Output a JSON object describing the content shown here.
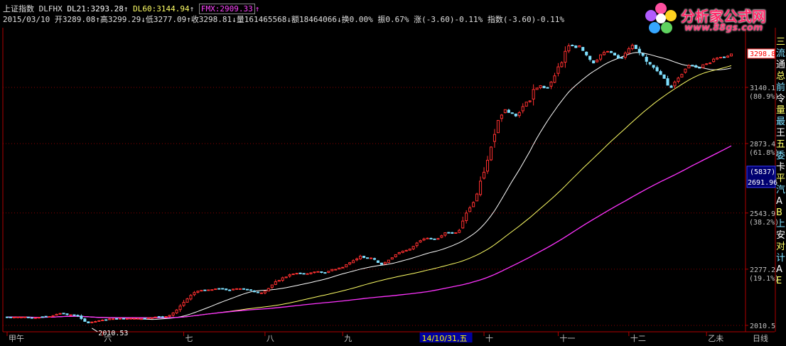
{
  "header": {
    "index_name": "上证指数",
    "indicator": "DLFHX",
    "dl21_label": "DL21:3293.28",
    "dl60_label": "DL60:3144.94",
    "fmx_label": "FMX:2909.33",
    "date": "2015/03/10",
    "open": "开3289.08",
    "high": "高3299.29",
    "low": "低3277.09",
    "close": "收3298.81",
    "volume": "量161465568",
    "amount": "额18464066",
    "turnover": "换0.00%",
    "amplitude": "振0.67%",
    "change": "涨(-3.60)-0.11%",
    "index_change": "指数(-3.60)-0.11%"
  },
  "logo": {
    "name": "分析家公式网",
    "url": "www.88gs.com"
  },
  "right_panel": [
    "三",
    "流",
    "通",
    "总",
    "前",
    "令",
    "量",
    "最",
    "王",
    "五",
    "委",
    "卡",
    "平",
    "汽",
    "A",
    "B",
    "上",
    "安",
    "对",
    "计",
    "A",
    "E"
  ],
  "colors": {
    "bull": "#ff3030",
    "bear": "#7fe0ff",
    "ma21": "#ffffff",
    "ma60": "#ffff66",
    "fmx": "#ff33ff",
    "axis": "#b00000",
    "grid": "#8b0000",
    "price_box": "#ffffff"
  },
  "chart_data": {
    "type": "candlestick",
    "price_range": [
      1980,
      3420
    ],
    "y_ticks": [
      {
        "value": 3140.1,
        "label": "3140.1",
        "pct": "(80.9%)"
      },
      {
        "value": 2873.4,
        "label": "2873.4",
        "pct": "(61.8%)"
      },
      {
        "value": 2543.9,
        "label": "2543.9",
        "pct": "(38.2%)"
      },
      {
        "value": 2277.2,
        "label": "2277.2",
        "pct": "(19.1%)"
      },
      {
        "value": 2010.5,
        "label": "2010.5",
        "pct": ""
      }
    ],
    "current_price": {
      "value": 3298.8,
      "label": "3298.8"
    },
    "cursor": {
      "value": 2691.96,
      "label": "2691.96",
      "count": "(5837)"
    },
    "low_annotation": {
      "value": 2010.53,
      "label": "2010.53",
      "index": 24
    },
    "x_labels": [
      {
        "label": "甲午",
        "index": 0
      },
      {
        "label": "六",
        "index": 27
      },
      {
        "label": "七",
        "index": 50
      },
      {
        "label": "八",
        "index": 73
      },
      {
        "label": "九",
        "index": 95
      },
      {
        "label": "14/10/31,五",
        "index": 117
      },
      {
        "label": "十",
        "index": 135
      },
      {
        "label": "十一",
        "index": 156
      },
      {
        "label": "十二",
        "index": 176
      },
      {
        "label": "乙未",
        "index": 198
      },
      {
        "label": "日线",
        "index": 215
      }
    ],
    "closes": [
      2050.2,
      2049.8,
      2049.2,
      2049.8,
      2049.5,
      2050.3,
      2048.3,
      2045.5,
      2046.5,
      2048.1,
      2049.9,
      2051.4,
      2052.5,
      2056.4,
      2063.1,
      2067.0,
      2066.2,
      2061.8,
      2061.0,
      2058.7,
      2054.9,
      2042.9,
      2029.4,
      2022.5,
      2026.1,
      2028.9,
      2032.7,
      2035.7,
      2037.1,
      2041.4,
      2041.6,
      2041.4,
      2043.3,
      2042.0,
      2042.8,
      2043.6,
      2043.1,
      2043.3,
      2041.9,
      2042.8,
      2045.6,
      2046.6,
      2050.3,
      2052.1,
      2049.7,
      2052.5,
      2057.9,
      2069.4,
      2083.6,
      2102.1,
      2119.6,
      2136.3,
      2152.8,
      2166.3,
      2172.9,
      2176.8,
      2176.0,
      2179.0,
      2180.0,
      2183.8,
      2184.7,
      2183.9,
      2179.0,
      2176.1,
      2182.8,
      2184.6,
      2184.4,
      2182.5,
      2180.5,
      2177.8,
      2169.6,
      2166.6,
      2164.7,
      2172.7,
      2185.2,
      2202.3,
      2217.9,
      2224.3,
      2236.4,
      2240.4,
      2250.7,
      2254.8,
      2257.5,
      2257.6,
      2256.4,
      2255.8,
      2260.1,
      2264.1,
      2266.0,
      2262.4,
      2260.5,
      2267.4,
      2275.9,
      2276.5,
      2282.9,
      2286.0,
      2298.5,
      2308.1,
      2317.6,
      2326.1,
      2338.9,
      2331.9,
      2329.6,
      2330.3,
      2323.8,
      2308.8,
      2300.2,
      2309.4,
      2320.2,
      2331.7,
      2346.0,
      2355.9,
      2362.9,
      2366.6,
      2372.7,
      2385.4,
      2401.3,
      2412.8,
      2421.1,
      2424.4,
      2421.5,
      2419.3,
      2422.6,
      2436.1,
      2450.3,
      2450.8,
      2448.6,
      2450.4,
      2461.6,
      2505.7,
      2543.8,
      2568.1,
      2593.5,
      2634.0,
      2695.2,
      2737.4,
      2794.2,
      2857.0,
      2916.8,
      2983.5,
      3008.9,
      3034.5,
      3021.0,
      3016.3,
      3004.7,
      3020.4,
      3049.0,
      3070.2,
      3076.1,
      3130.2,
      3137.1,
      3148.2,
      3138.1,
      3137.8,
      3165.2,
      3195.0,
      3237.5,
      3257.2,
      3311.2,
      3337.3,
      3339.0,
      3329.1,
      3337.4,
      3315.2,
      3294.3,
      3272.8,
      3256.0,
      3269.3,
      3294.9,
      3306.6,
      3310.8,
      3305.1,
      3293.4,
      3278.3,
      3280.2,
      3302.7,
      3323.6,
      3339.8,
      3324.0,
      3305.0,
      3292.2,
      3263.7,
      3251.2,
      3235.3,
      3218.6,
      3201.0,
      3182.9,
      3150.5,
      3139.6,
      3165.4,
      3184.3,
      3201.8,
      3227.0,
      3243.6,
      3243.8,
      3235.5,
      3233.5,
      3247.8,
      3252.2,
      3256.0,
      3274.3,
      3279.7,
      3283.4,
      3282.6,
      3288.5,
      3298.8
    ],
    "series": [
      {
        "name": "DL21",
        "period": 21
      },
      {
        "name": "DL60",
        "period": 60
      },
      {
        "name": "FMX",
        "period": 120
      }
    ]
  }
}
